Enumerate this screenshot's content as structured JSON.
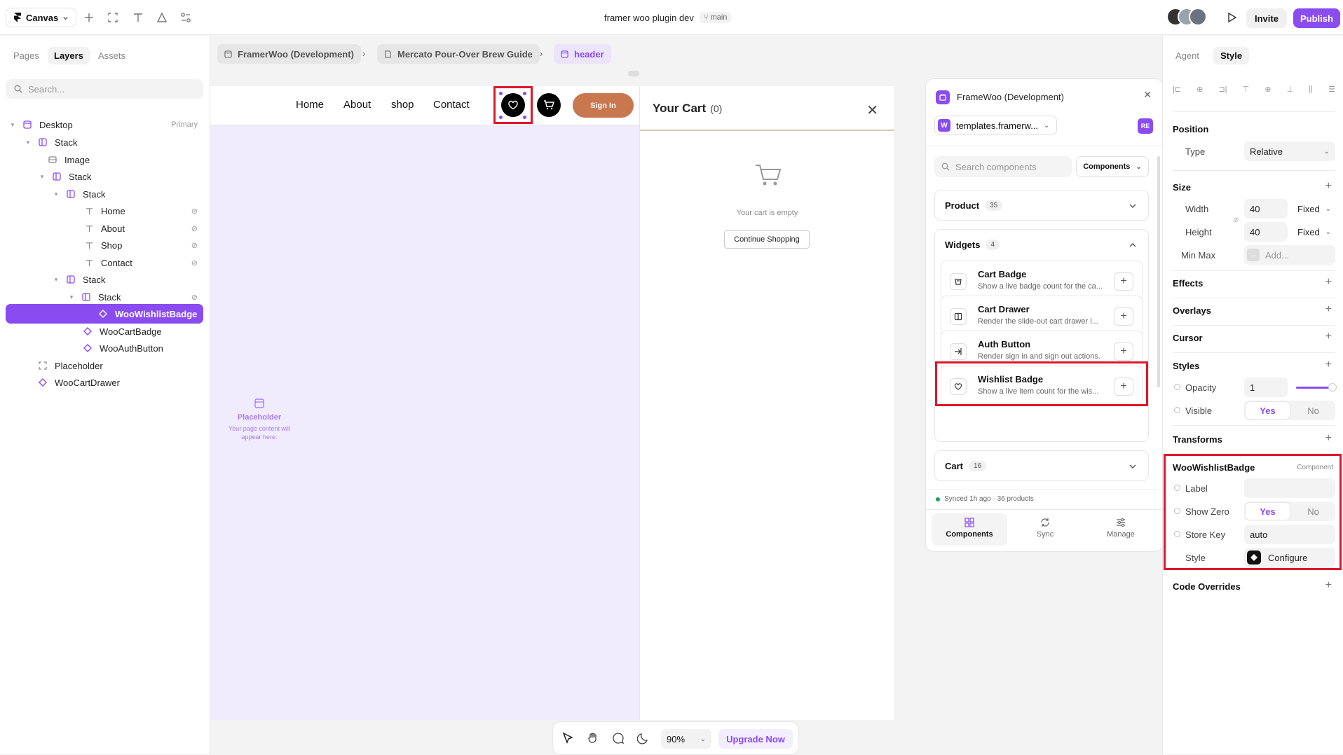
{
  "topbar": {
    "canvas_label": "Canvas",
    "project": "framer woo plugin dev",
    "branch": "main",
    "invite": "Invite",
    "publish": "Publish"
  },
  "left": {
    "tabs": [
      "Pages",
      "Layers",
      "Assets"
    ],
    "search_placeholder": "Search...",
    "layers": [
      {
        "label": "Desktop",
        "extra": "Primary"
      },
      {
        "label": "Stack"
      },
      {
        "label": "Image"
      },
      {
        "label": "Stack"
      },
      {
        "label": "Stack"
      },
      {
        "label": "Home"
      },
      {
        "label": "About"
      },
      {
        "label": "Shop"
      },
      {
        "label": "Contact"
      },
      {
        "label": "Stack"
      },
      {
        "label": "Stack"
      },
      {
        "label": "WooWishlistBadge"
      },
      {
        "label": "WooCartBadge"
      },
      {
        "label": "WooAuthButton"
      },
      {
        "label": "Placeholder"
      },
      {
        "label": "WooCartDrawer"
      }
    ]
  },
  "breadcrumbs": [
    "FramerWoo (Development)",
    "Mercato Pour-Over Brew Guide",
    "header"
  ],
  "frame": {
    "nav": [
      "Home",
      "About",
      "shop",
      "Contact"
    ],
    "signin": "Sign In",
    "placeholder_title": "Placeholder",
    "placeholder_sub": "Your page content will appear here."
  },
  "cart": {
    "title": "Your Cart",
    "count": "(0)",
    "empty": "Your cart is empty",
    "continue": "Continue Shopping"
  },
  "plugin": {
    "title": "FrameWoo (Development)",
    "site": "templates.framerw...",
    "avatar": "RE",
    "search_placeholder": "Search components",
    "filter": "Components",
    "groups": [
      {
        "name": "Product",
        "count": "35"
      },
      {
        "name": "Widgets",
        "count": "4"
      },
      {
        "name": "Cart",
        "count": "16"
      }
    ],
    "widgets": [
      {
        "title": "Cart Badge",
        "desc": "Show a live badge count for the ca..."
      },
      {
        "title": "Cart Drawer",
        "desc": "Render the slide-out cart drawer l..."
      },
      {
        "title": "Auth Button",
        "desc": "Render sign in and sign out actions."
      },
      {
        "title": "Wishlist Badge",
        "desc": "Show a live item count for the wis..."
      }
    ],
    "sync_status": "Synced 1h ago · 36 products",
    "tabs": [
      "Components",
      "Sync",
      "Manage"
    ]
  },
  "bottombar": {
    "zoom": "90%",
    "upgrade": "Upgrade Now"
  },
  "right": {
    "tabs": [
      "Agent",
      "Style"
    ],
    "position": {
      "title": "Position",
      "type_label": "Type",
      "type_value": "Relative"
    },
    "size": {
      "title": "Size",
      "width_label": "Width",
      "width": "40",
      "width_mode": "Fixed",
      "height_label": "Height",
      "height": "40",
      "height_mode": "Fixed",
      "minmax_label": "Min Max",
      "minmax_placeholder": "Add..."
    },
    "effects": "Effects",
    "overlays": "Overlays",
    "cursor": "Cursor",
    "styles": {
      "title": "Styles",
      "opacity_label": "Opacity",
      "opacity": "1",
      "visible_label": "Visible",
      "yes": "Yes",
      "no": "No"
    },
    "transforms": "Transforms",
    "component": {
      "title": "WooWishlistBadge",
      "tag": "Component",
      "label_label": "Label",
      "label_value": "",
      "showzero_label": "Show Zero",
      "yes": "Yes",
      "no": "No",
      "storekey_label": "Store Key",
      "storekey": "auto",
      "style_label": "Style",
      "configure": "Configure"
    },
    "code_overrides": "Code Overrides"
  }
}
